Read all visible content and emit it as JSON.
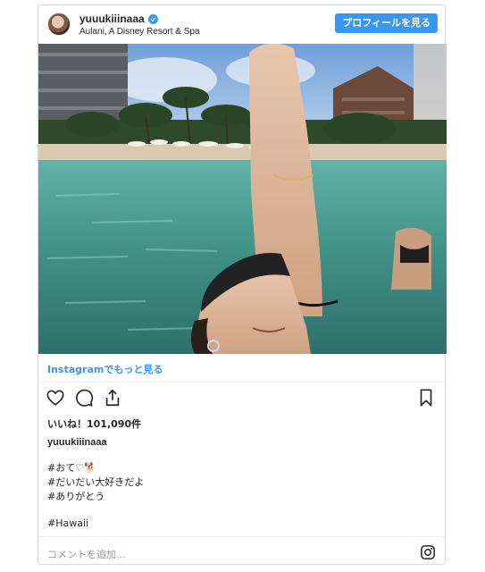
{
  "post": {
    "username": "yuuukiiinaaa",
    "location": "Aulani, A Disney Resort & Spa",
    "profile_button": "プロフィールを見る",
    "photo_alt": "",
    "more_link": "Instagramでもっと見る",
    "likes": "いいね！101,090件",
    "caption_user": "yuuukiiinaaa",
    "caption_lines": [
      "#おて♡🐕",
      "#だいだい大好きだよ",
      "#ありがとう"
    ],
    "hashtag": "#Hawaii",
    "comment_placeholder": "コメントを追加..."
  },
  "colors": {
    "accent": "#3897f0",
    "border": "#dbdbdb",
    "muted": "#999999"
  },
  "icons": [
    "verified-badge-icon",
    "heart-icon",
    "comment-icon",
    "share-icon",
    "bookmark-icon",
    "instagram-icon"
  ]
}
